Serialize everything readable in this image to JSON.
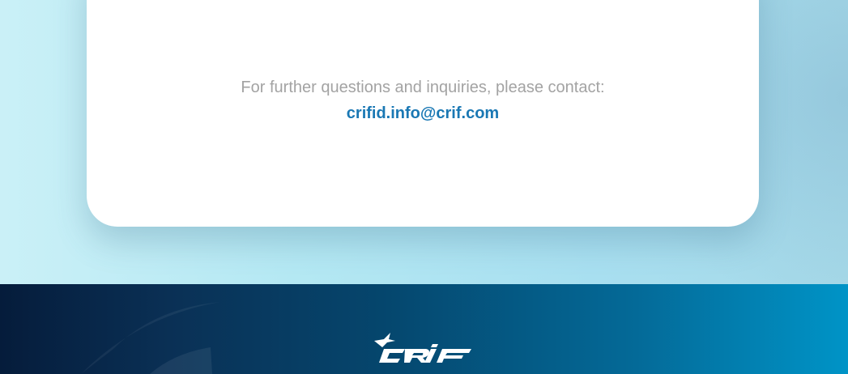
{
  "contact": {
    "prompt": "For further questions and inquiries, please contact:",
    "email": "crifid.info@crif.com"
  },
  "footer": {
    "logo_text": "CRIF"
  },
  "colors": {
    "email_link": "#1a78b4",
    "prompt_text": "#a3a3a3",
    "footer_dark": "#051c3b",
    "footer_light": "#0094c7"
  }
}
